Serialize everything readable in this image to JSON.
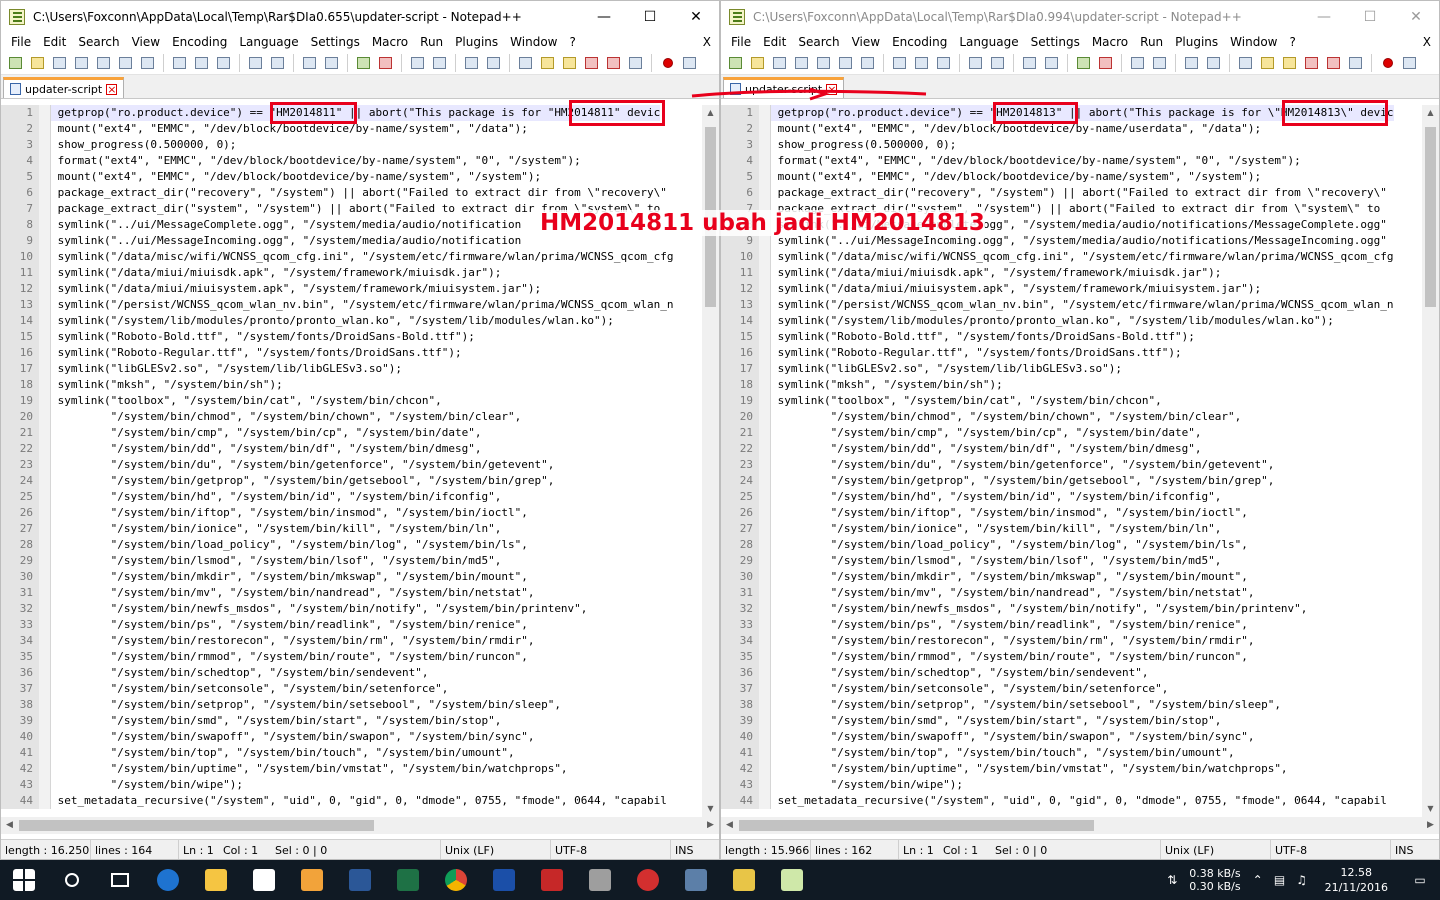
{
  "left": {
    "title": "C:\\Users\\Foxconn\\AppData\\Local\\Temp\\Rar$DIa0.655\\updater-script - Notepad++",
    "menu": [
      "File",
      "Edit",
      "Search",
      "View",
      "Encoding",
      "Language",
      "Settings",
      "Macro",
      "Run",
      "Plugins",
      "Window",
      "?"
    ],
    "menu_close": "X",
    "tab_label": "updater-script",
    "status": {
      "length": "length : 16.250",
      "lines": "lines : 164",
      "ln": "Ln : 1",
      "col": "Col : 1",
      "sel": "Sel : 0 | 0",
      "eol": "Unix (LF)",
      "enc": "UTF-8",
      "mode": "INS"
    },
    "lines": [
      "getprop(\"ro.product.device\") == \"HM2014811\" || abort(\"This package is for \"HM2014811\" devic",
      "mount(\"ext4\", \"EMMC\", \"/dev/block/bootdevice/by-name/system\", \"/data\");",
      "show_progress(0.500000, 0);",
      "format(\"ext4\", \"EMMC\", \"/dev/block/bootdevice/by-name/system\", \"0\", \"/system\");",
      "mount(\"ext4\", \"EMMC\", \"/dev/block/bootdevice/by-name/system\", \"/system\");",
      "package_extract_dir(\"recovery\", \"/system\") || abort(\"Failed to extract dir from \\\"recovery\\\"",
      "package_extract_dir(\"system\", \"/system\") || abort(\"Failed to extract dir from \\\"system\\\" to",
      "symlink(\"../ui/MessageComplete.ogg\", \"/system/media/audio/notification",
      "symlink(\"../ui/MessageIncoming.ogg\", \"/system/media/audio/notification",
      "symlink(\"/data/misc/wifi/WCNSS_qcom_cfg.ini\", \"/system/etc/firmware/wlan/prima/WCNSS_qcom_cfg",
      "symlink(\"/data/miui/miuisdk.apk\", \"/system/framework/miuisdk.jar\");",
      "symlink(\"/data/miui/miuisystem.apk\", \"/system/framework/miuisystem.jar\");",
      "symlink(\"/persist/WCNSS_qcom_wlan_nv.bin\", \"/system/etc/firmware/wlan/prima/WCNSS_qcom_wlan_n",
      "symlink(\"/system/lib/modules/pronto/pronto_wlan.ko\", \"/system/lib/modules/wlan.ko\");",
      "symlink(\"Roboto-Bold.ttf\", \"/system/fonts/DroidSans-Bold.ttf\");",
      "symlink(\"Roboto-Regular.ttf\", \"/system/fonts/DroidSans.ttf\");",
      "symlink(\"libGLESv2.so\", \"/system/lib/libGLESv3.so\");",
      "symlink(\"mksh\", \"/system/bin/sh\");",
      "symlink(\"toolbox\", \"/system/bin/cat\", \"/system/bin/chcon\",",
      "        \"/system/bin/chmod\", \"/system/bin/chown\", \"/system/bin/clear\",",
      "        \"/system/bin/cmp\", \"/system/bin/cp\", \"/system/bin/date\",",
      "        \"/system/bin/dd\", \"/system/bin/df\", \"/system/bin/dmesg\",",
      "        \"/system/bin/du\", \"/system/bin/getenforce\", \"/system/bin/getevent\",",
      "        \"/system/bin/getprop\", \"/system/bin/getsebool\", \"/system/bin/grep\",",
      "        \"/system/bin/hd\", \"/system/bin/id\", \"/system/bin/ifconfig\",",
      "        \"/system/bin/iftop\", \"/system/bin/insmod\", \"/system/bin/ioctl\",",
      "        \"/system/bin/ionice\", \"/system/bin/kill\", \"/system/bin/ln\",",
      "        \"/system/bin/load_policy\", \"/system/bin/log\", \"/system/bin/ls\",",
      "        \"/system/bin/lsmod\", \"/system/bin/lsof\", \"/system/bin/md5\",",
      "        \"/system/bin/mkdir\", \"/system/bin/mkswap\", \"/system/bin/mount\",",
      "        \"/system/bin/mv\", \"/system/bin/nandread\", \"/system/bin/netstat\",",
      "        \"/system/bin/newfs_msdos\", \"/system/bin/notify\", \"/system/bin/printenv\",",
      "        \"/system/bin/ps\", \"/system/bin/readlink\", \"/system/bin/renice\",",
      "        \"/system/bin/restorecon\", \"/system/bin/rm\", \"/system/bin/rmdir\",",
      "        \"/system/bin/rmmod\", \"/system/bin/route\", \"/system/bin/runcon\",",
      "        \"/system/bin/schedtop\", \"/system/bin/sendevent\",",
      "        \"/system/bin/setconsole\", \"/system/bin/setenforce\",",
      "        \"/system/bin/setprop\", \"/system/bin/setsebool\", \"/system/bin/sleep\",",
      "        \"/system/bin/smd\", \"/system/bin/start\", \"/system/bin/stop\",",
      "        \"/system/bin/swapoff\", \"/system/bin/swapon\", \"/system/bin/sync\",",
      "        \"/system/bin/top\", \"/system/bin/touch\", \"/system/bin/umount\",",
      "        \"/system/bin/uptime\", \"/system/bin/vmstat\", \"/system/bin/watchprops\",",
      "        \"/system/bin/wipe\");",
      "set_metadata_recursive(\"/system\", \"uid\", 0, \"gid\", 0, \"dmode\", 0755, \"fmode\", 0644, \"capabil"
    ]
  },
  "right": {
    "title": "C:\\Users\\Foxconn\\AppData\\Local\\Temp\\Rar$DIa0.994\\updater-script - Notepad++",
    "menu": [
      "File",
      "Edit",
      "Search",
      "View",
      "Encoding",
      "Language",
      "Settings",
      "Macro",
      "Run",
      "Plugins",
      "Window",
      "?"
    ],
    "menu_close": "X",
    "tab_label": "updater-script",
    "status": {
      "length": "length : 15.966",
      "lines": "lines : 162",
      "ln": "Ln : 1",
      "col": "Col : 1",
      "sel": "Sel : 0 | 0",
      "eol": "Unix (LF)",
      "enc": "UTF-8",
      "mode": "INS"
    },
    "lines": [
      "getprop(\"ro.product.device\") == \"HM2014813\" || abort(\"This package is for \\\"HM2014813\\\" devic",
      "mount(\"ext4\", \"EMMC\", \"/dev/block/bootdevice/by-name/userdata\", \"/data\");",
      "show_progress(0.500000, 0);",
      "format(\"ext4\", \"EMMC\", \"/dev/block/bootdevice/by-name/system\", \"0\", \"/system\");",
      "mount(\"ext4\", \"EMMC\", \"/dev/block/bootdevice/by-name/system\", \"/system\");",
      "package_extract_dir(\"recovery\", \"/system\") || abort(\"Failed to extract dir from \\\"recovery\\\"",
      "package_extract_dir(\"system\", \"/system\") || abort(\"Failed to extract dir from \\\"system\\\" to",
      "symlink(\"../ui/MessageComplete.ogg\", \"/system/media/audio/notifications/MessageComplete.ogg\"",
      "symlink(\"../ui/MessageIncoming.ogg\", \"/system/media/audio/notifications/MessageIncoming.ogg\"",
      "symlink(\"/data/misc/wifi/WCNSS_qcom_cfg.ini\", \"/system/etc/firmware/wlan/prima/WCNSS_qcom_cfg",
      "symlink(\"/data/miui/miuisdk.apk\", \"/system/framework/miuisdk.jar\");",
      "symlink(\"/data/miui/miuisystem.apk\", \"/system/framework/miuisystem.jar\");",
      "symlink(\"/persist/WCNSS_qcom_wlan_nv.bin\", \"/system/etc/firmware/wlan/prima/WCNSS_qcom_wlan_n",
      "symlink(\"/system/lib/modules/pronto/pronto_wlan.ko\", \"/system/lib/modules/wlan.ko\");",
      "symlink(\"Roboto-Bold.ttf\", \"/system/fonts/DroidSans-Bold.ttf\");",
      "symlink(\"Roboto-Regular.ttf\", \"/system/fonts/DroidSans.ttf\");",
      "symlink(\"libGLESv2.so\", \"/system/lib/libGLESv3.so\");",
      "symlink(\"mksh\", \"/system/bin/sh\");",
      "symlink(\"toolbox\", \"/system/bin/cat\", \"/system/bin/chcon\",",
      "        \"/system/bin/chmod\", \"/system/bin/chown\", \"/system/bin/clear\",",
      "        \"/system/bin/cmp\", \"/system/bin/cp\", \"/system/bin/date\",",
      "        \"/system/bin/dd\", \"/system/bin/df\", \"/system/bin/dmesg\",",
      "        \"/system/bin/du\", \"/system/bin/getenforce\", \"/system/bin/getevent\",",
      "        \"/system/bin/getprop\", \"/system/bin/getsebool\", \"/system/bin/grep\",",
      "        \"/system/bin/hd\", \"/system/bin/id\", \"/system/bin/ifconfig\",",
      "        \"/system/bin/iftop\", \"/system/bin/insmod\", \"/system/bin/ioctl\",",
      "        \"/system/bin/ionice\", \"/system/bin/kill\", \"/system/bin/ln\",",
      "        \"/system/bin/load_policy\", \"/system/bin/log\", \"/system/bin/ls\",",
      "        \"/system/bin/lsmod\", \"/system/bin/lsof\", \"/system/bin/md5\",",
      "        \"/system/bin/mkdir\", \"/system/bin/mkswap\", \"/system/bin/mount\",",
      "        \"/system/bin/mv\", \"/system/bin/nandread\", \"/system/bin/netstat\",",
      "        \"/system/bin/newfs_msdos\", \"/system/bin/notify\", \"/system/bin/printenv\",",
      "        \"/system/bin/ps\", \"/system/bin/readlink\", \"/system/bin/renice\",",
      "        \"/system/bin/restorecon\", \"/system/bin/rm\", \"/system/bin/rmdir\",",
      "        \"/system/bin/rmmod\", \"/system/bin/route\", \"/system/bin/runcon\",",
      "        \"/system/bin/schedtop\", \"/system/bin/sendevent\",",
      "        \"/system/bin/setconsole\", \"/system/bin/setenforce\",",
      "        \"/system/bin/setprop\", \"/system/bin/setsebool\", \"/system/bin/sleep\",",
      "        \"/system/bin/smd\", \"/system/bin/start\", \"/system/bin/stop\",",
      "        \"/system/bin/swapoff\", \"/system/bin/swapon\", \"/system/bin/sync\",",
      "        \"/system/bin/top\", \"/system/bin/touch\", \"/system/bin/umount\",",
      "        \"/system/bin/uptime\", \"/system/bin/vmstat\", \"/system/bin/watchprops\",",
      "        \"/system/bin/wipe\");",
      "set_metadata_recursive(\"/system\", \"uid\", 0, \"gid\", 0, \"dmode\", 0755, \"fmode\", 0644, \"capabil"
    ]
  },
  "annotation": "HM2014811 ubah jadi HM2014813",
  "taskbar": {
    "net_up": "0.38 kB/s",
    "net_down": "0.30 kB/s",
    "time": "12.58",
    "date": "21/11/2016"
  },
  "colors": {
    "accent_red": "#e8001c",
    "taskbar_bg": "#101a24",
    "tab_highlight": "#f8a23b"
  }
}
